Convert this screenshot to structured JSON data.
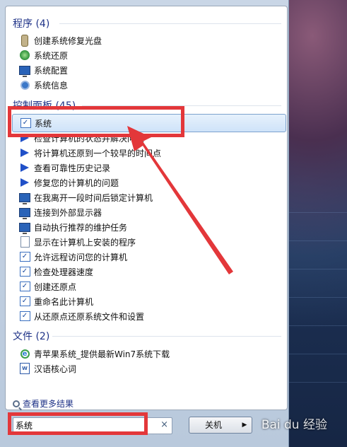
{
  "groups": {
    "programs": {
      "title": "程序 (4)",
      "items": [
        {
          "label": "创建系统修复光盘",
          "icon": "repair-disc-icon"
        },
        {
          "label": "系统还原",
          "icon": "system-restore-icon"
        },
        {
          "label": "系统配置",
          "icon": "system-config-icon"
        },
        {
          "label": "系统信息",
          "icon": "system-info-icon"
        }
      ]
    },
    "control_panel": {
      "title": "控制面板 (45)",
      "items": [
        {
          "label": "系统",
          "icon": "system-icon",
          "selected": true
        },
        {
          "label": "检查计算机的状态并解决问题",
          "icon": "flag-icon"
        },
        {
          "label": "将计算机还原到一个较早的时间点",
          "icon": "flag-icon"
        },
        {
          "label": "查看可靠性历史记录",
          "icon": "flag-icon"
        },
        {
          "label": "修复您的计算机的问题",
          "icon": "flag-icon"
        },
        {
          "label": "在我离开一段时间后锁定计算机",
          "icon": "monitor-icon"
        },
        {
          "label": "连接到外部显示器",
          "icon": "monitor-icon"
        },
        {
          "label": "自动执行推荐的维护任务",
          "icon": "monitor-icon"
        },
        {
          "label": "显示在计算机上安装的程序",
          "icon": "programs-icon"
        },
        {
          "label": "允许远程访问您的计算机",
          "icon": "system-icon"
        },
        {
          "label": "检查处理器速度",
          "icon": "system-icon"
        },
        {
          "label": "创建还原点",
          "icon": "system-icon"
        },
        {
          "label": "重命名此计算机",
          "icon": "system-icon"
        },
        {
          "label": "从还原点还原系统文件和设置",
          "icon": "system-icon"
        }
      ]
    },
    "files": {
      "title": "文件 (2)",
      "items": [
        {
          "label": "青苹果系统_提供最新Win7系统下载",
          "icon": "ie-icon"
        },
        {
          "label": "汉语核心词",
          "icon": "word-doc-icon"
        }
      ]
    }
  },
  "see_more": "查看更多结果",
  "search": {
    "value": "系统",
    "clear": "×"
  },
  "shutdown": {
    "label": "关机",
    "arrow": "▶"
  },
  "watermark": "Bai du 经验"
}
